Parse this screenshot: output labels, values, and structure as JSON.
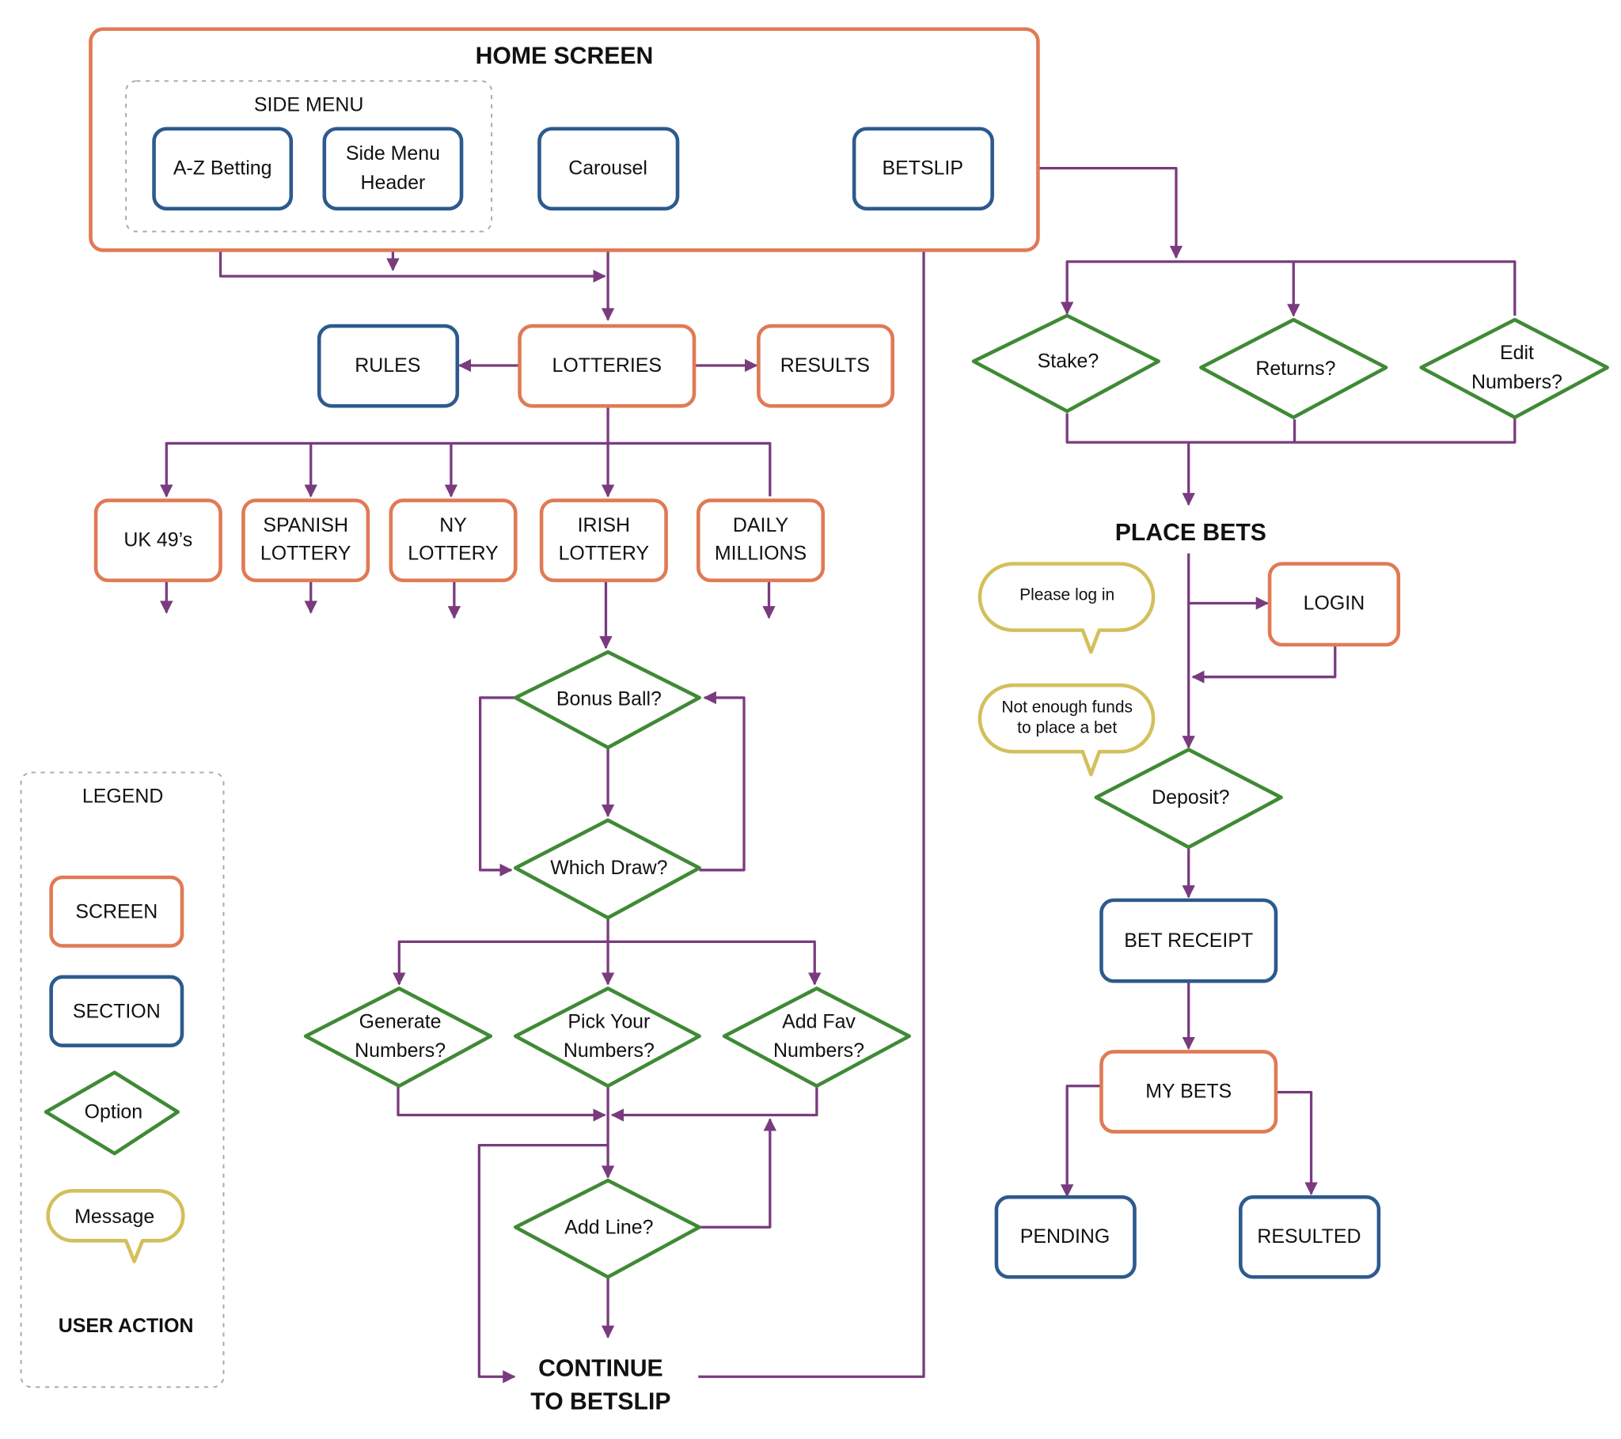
{
  "colors": {
    "screen": "#e07a55",
    "section": "#2d5a8e",
    "option": "#3f8a35",
    "message": "#d3c05c",
    "edge": "#7a3b7e"
  },
  "home": {
    "title": "HOME SCREEN",
    "side_menu": "SIDE MENU",
    "az_betting": "A-Z Betting",
    "side_menu_header_1": "Side Menu",
    "side_menu_header_2": "Header",
    "carousel": "Carousel",
    "betslip": "BETSLIP"
  },
  "lotteries": {
    "rules": "RULES",
    "lotteries": "LOTTERIES",
    "results": "RESULTS"
  },
  "games": [
    {
      "l1": "UK 49’s",
      "l2": ""
    },
    {
      "l1": "SPANISH",
      "l2": "LOTTERY"
    },
    {
      "l1": "NY",
      "l2": "LOTTERY"
    },
    {
      "l1": "IRISH",
      "l2": "LOTTERY"
    },
    {
      "l1": "DAILY",
      "l2": "MILLIONS"
    }
  ],
  "flow": {
    "bonus_ball": "Bonus Ball?",
    "which_draw": "Which Draw?",
    "generate_1": "Generate",
    "generate_2": "Numbers?",
    "pick_1": "Pick Your",
    "pick_2": "Numbers?",
    "fav_1": "Add Fav",
    "fav_2": "Numbers?",
    "add_line": "Add Line?",
    "continue_1": "CONTINUE",
    "continue_2": "TO BETSLIP"
  },
  "betslip_flow": {
    "stake": "Stake?",
    "returns": "Returns?",
    "edit_1": "Edit",
    "edit_2": "Numbers?",
    "place_bets": "PLACE BETS",
    "please_login": "Please log in",
    "login": "LOGIN",
    "funds_1": "Not enough funds",
    "funds_2": "to place a bet",
    "deposit": "Deposit?",
    "bet_receipt": "BET RECEIPT",
    "my_bets": "MY BETS",
    "pending": "PENDING",
    "resulted": "RESULTED"
  },
  "legend": {
    "title": "LEGEND",
    "screen": "SCREEN",
    "section": "SECTION",
    "option": "Option",
    "message": "Message",
    "user_action": "USER ACTION"
  }
}
